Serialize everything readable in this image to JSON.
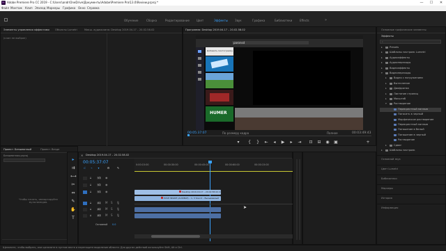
{
  "titlebar": {
    "title": "Adobe Premiere Pro CC 2019 - C:\\Users\\andr\\OneDrive\\Документы\\Adobe\\Premiere Pro\\13.0\\Review.prproj *",
    "minimize": "—",
    "maximize": "☐",
    "close": "✕"
  },
  "menu": [
    "Файл",
    "Монтаж",
    "Клип",
    "Эпизод",
    "Маркеры",
    "Графика",
    "Окно",
    "Справка"
  ],
  "workspaces": [
    "Обучение",
    "Сборка",
    "Редактирование",
    "Цвет",
    "Эффекты",
    "Звук",
    "Графика",
    "Библиотеки",
    "Effects"
  ],
  "workspace_active": "Эффекты",
  "effect_controls": {
    "tabs": [
      "Элементы управления эффектами",
      "Объекты Lumetri",
      "Микш. аудиоклипа: Desktop 2019.04.17 – 20.02.58.02"
    ],
    "empty_text": "(клип не выбран)"
  },
  "program": {
    "tab": "Программа: Desktop 2019.04.17 – 20.02.58.02",
    "timecode_left": "00:05:37:07",
    "fit": "По размеру кадра",
    "quality": "Полное",
    "timecode_right": "00:03:49:43",
    "playhead_fraction": 0.0,
    "video": {
      "url": "paronsd",
      "search_text": "Добавить пиктограмму",
      "thumb_caption": "HUMER"
    },
    "buttons": [
      "marker-in",
      "marker-out",
      "go-to-in",
      "step-back",
      "play",
      "step-forward",
      "go-to-out",
      "lift",
      "extract",
      "export-frame",
      "compare"
    ]
  },
  "project": {
    "tabs": [
      "Проект: Безымянный",
      "Проект: Везде"
    ],
    "file": "Безымянная.prproj",
    "drop_text": "Чтобы начать, импортируйте мультимедиа."
  },
  "timeline": {
    "tab": "Desktop 2019.04.17 – 20.02.58.02",
    "timecode": "00:05:37:07",
    "ruler": [
      "0:00:15:00",
      "00:00:30:00",
      "00:00:45:00",
      "00:00:60:00",
      "00:00:15:00"
    ],
    "tracks_video": [
      "V3",
      "V2",
      "V1"
    ],
    "tracks_audio": [
      "A1",
      "A2",
      "A3"
    ],
    "master": "Основной",
    "master_value": "0.0",
    "clip_video_1": "Desktop 2019.04.17 – 20.02.58.02.mp4 [V]",
    "clip_video_2": "PUSH INSIDE (AUDIBLE) – 1, 3 Sound – Вызываемый трек"
  },
  "effects_panel": {
    "header": "Основные графические элементы",
    "title": "Эффекты",
    "items": [
      {
        "label": "Presets",
        "level": 0,
        "expanded": false
      },
      {
        "label": "Шаблоны настроек Lumetri",
        "level": 0,
        "expanded": false
      },
      {
        "label": "Аудиоэффекты",
        "level": 0,
        "expanded": false
      },
      {
        "label": "Аудиопереходы",
        "level": 0,
        "expanded": false
      },
      {
        "label": "Видеоэффекты",
        "level": 0,
        "expanded": false
      },
      {
        "label": "Видеопереходы",
        "level": 0,
        "expanded": true
      },
      {
        "label": "Видео с погружением",
        "level": 1,
        "expanded": false
      },
      {
        "label": "Вытеснение",
        "level": 1,
        "expanded": false
      },
      {
        "label": "Диафрагма",
        "level": 1,
        "expanded": false
      },
      {
        "label": "Листание страниц",
        "level": 1,
        "expanded": false
      },
      {
        "label": "Масштаб",
        "level": 1,
        "expanded": false
      },
      {
        "label": "Растворение",
        "level": 1,
        "expanded": true
      },
      {
        "label": "Перекрестный наплыв",
        "level": 2,
        "selected": true
      },
      {
        "label": "Погасить в черный",
        "level": 2
      },
      {
        "label": "Морфическое растворение",
        "level": 2
      },
      {
        "label": "Перекрестный наплыв",
        "level": 2
      },
      {
        "label": "Погашение в белый",
        "level": 2
      },
      {
        "label": "Погашение в черный",
        "level": 2
      },
      {
        "label": "Растворение",
        "level": 2
      },
      {
        "label": "Сдвиг",
        "level": 1,
        "expanded": false
      },
      {
        "label": "Шаблоны настроек",
        "level": 0,
        "expanded": false
      }
    ],
    "sections": [
      "Основной звук",
      "Цвет Lumetri",
      "Библиотеки",
      "Маркеры",
      "История",
      "Информация"
    ]
  },
  "status": {
    "text": "Щелкните, чтобы выбрать, или щелкните в пустом месте и перетащите выделение области. Для других действий используйте Shift, Alt и Ctrl."
  },
  "colors": {
    "accent": "#3aa3ff",
    "playhead": "#3aa3ff",
    "clip_video": "#9fbfe6",
    "clip_audio": "#4d6fa3",
    "work_area": "#c8c832"
  }
}
